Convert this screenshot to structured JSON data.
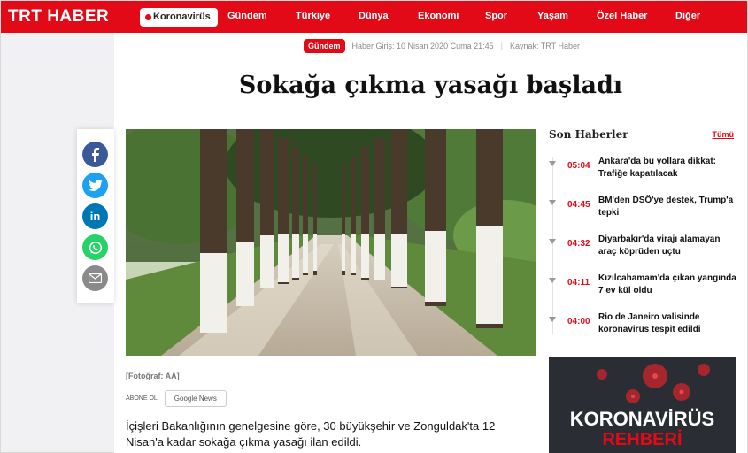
{
  "brand": {
    "logo": "TRT HABER"
  },
  "nav": {
    "active": "Koronavirüs",
    "items": [
      "Gündem",
      "Türkiye",
      "Dünya",
      "Ekonomi",
      "Spor",
      "Yaşam",
      "Özel Haber",
      "Diğer"
    ]
  },
  "article": {
    "category": "Gündem",
    "published": "Haber Giriş: 10 Nisan 2020 Cuma 21:45",
    "source": "Kaynak: TRT Haber",
    "title": "Sokağa çıkma yasağı başladı",
    "caption": "[Fotoğraf: AA]",
    "subscribe_label": "ABONE OL",
    "google_news": "Google News",
    "lead": "İçişleri Bakanlığının genelgesine göre, 30 büyükşehir ve Zonguldak'ta 12 Nisan'a kadar sokağa çıkma yasağı ilan edildi."
  },
  "sidebar": {
    "title": "Son Haberler",
    "all_link": "Tümü",
    "items": [
      {
        "time": "05:04",
        "text": "Ankara'da bu yollara dikkat: Trafiğe kapatılacak"
      },
      {
        "time": "04:45",
        "text": "BM'den DSÖ'ye destek, Trump'a tepki"
      },
      {
        "time": "04:32",
        "text": "Diyarbakır'da virajı alamayan araç köprüden uçtu"
      },
      {
        "time": "04:11",
        "text": "Kızılcahamam'da çıkan yangında 7 ev kül oldu"
      },
      {
        "time": "04:00",
        "text": "Rio de Janeiro valisinde koronavirüs tespit edildi"
      }
    ],
    "promo": {
      "title": "KORONAVİRÜS",
      "subtitle": "REHBERİ"
    }
  },
  "share": {
    "icons": [
      "facebook-icon",
      "twitter-icon",
      "linkedin-icon",
      "whatsapp-icon",
      "email-icon"
    ]
  },
  "colors": {
    "brand_red": "#e30a17",
    "facebook": "#3b5998",
    "twitter": "#1da1f2",
    "linkedin": "#0077b5",
    "whatsapp": "#25d366",
    "email": "#8a8a8a"
  }
}
